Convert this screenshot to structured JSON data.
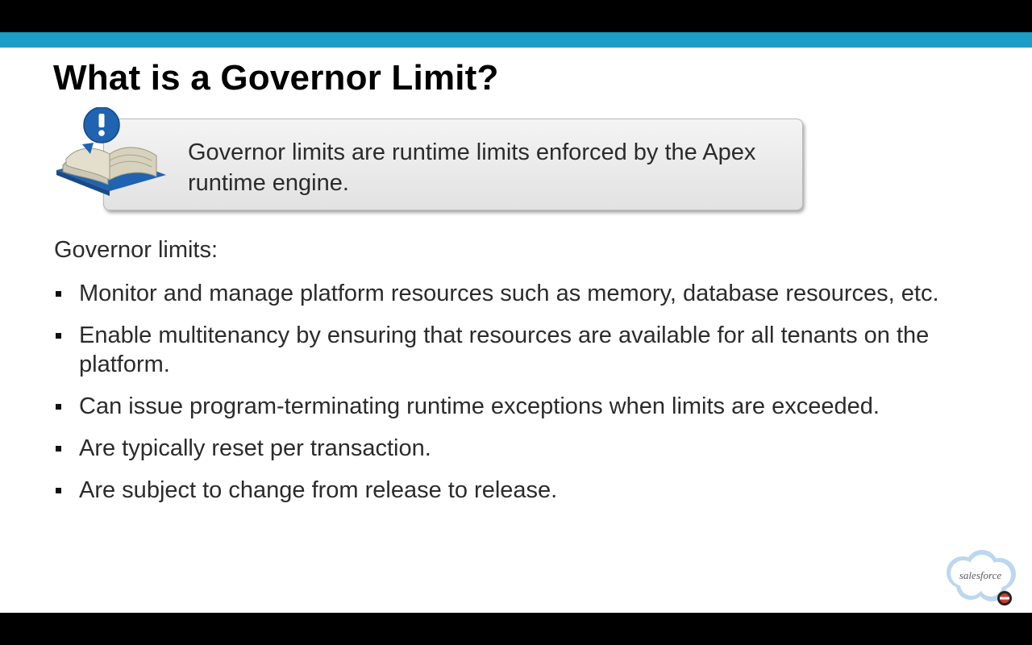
{
  "slide": {
    "title": "What is a Governor Limit?",
    "callout": {
      "text": "Governor limits are runtime limits enforced by the Apex runtime engine.",
      "icon": "book-with-alert-icon"
    },
    "intro": "Governor limits:",
    "bullets": [
      "Monitor and manage platform resources such as memory, database resources, etc.",
      "Enable multitenancy by ensuring that resources are available for all tenants on the platform.",
      "Can issue program-terminating runtime exceptions when limits are exceeded.",
      "Are typically reset per transaction.",
      "Are subject to change from release to release."
    ],
    "logo": {
      "text": "salesforce",
      "icon": "salesforce-cloud-logo"
    }
  },
  "colors": {
    "accent_bar": "#1b9dc7",
    "callout_bg": "#e8e8e8",
    "text": "#2b2b2b",
    "icon_blue": "#1f63b1"
  }
}
